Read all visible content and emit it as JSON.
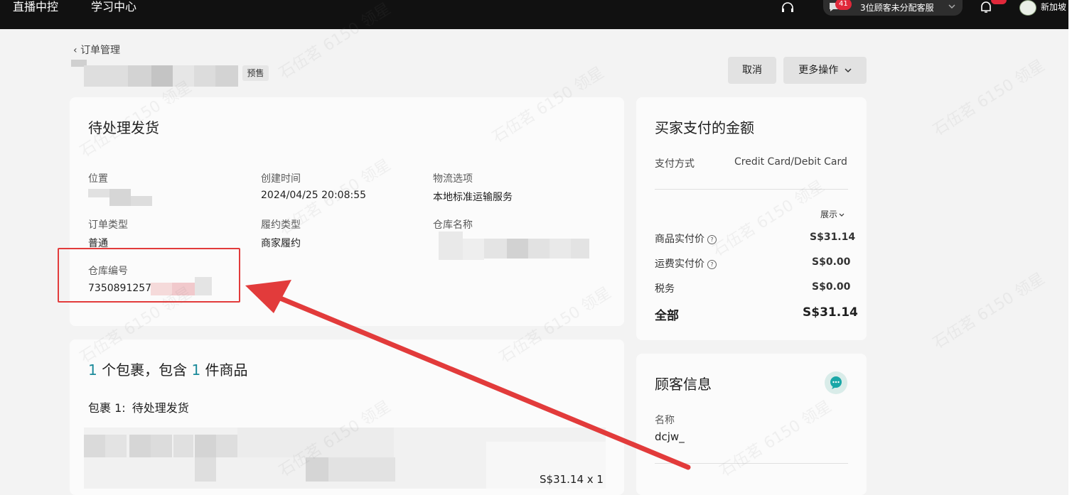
{
  "topbar": {
    "nav": [
      "直播中控",
      "学习中心"
    ],
    "chat_badge": "41",
    "chat_text": "3位顾客未分配客服",
    "region": "新加坡"
  },
  "page": {
    "breadcrumb": "订单管理",
    "presale_tag": "预售",
    "cancel_label": "取消",
    "more_label": "更多操作"
  },
  "status_card": {
    "title": "待处理发货",
    "location_label": "位置",
    "created_label": "创建时间",
    "created_value": "2024/04/25 20:08:55",
    "logistics_label": "物流选项",
    "logistics_value": "本地标准运输服务",
    "order_type_label": "订单类型",
    "order_type_value": "普通",
    "fulfill_label": "履约类型",
    "fulfill_value": "商家履约",
    "warehouse_name_label": "仓库名称",
    "warehouse_no_label": "仓库编号",
    "warehouse_no_value": "7350891257"
  },
  "package_card": {
    "count_pkg": "1",
    "text_mid": "个包裹，包含",
    "count_items": "1",
    "text_end": "件商品",
    "pkg_label": "包裹 1:",
    "pkg_status": "待处理发货",
    "price_qty": "S$31.14 x 1"
  },
  "payment_card": {
    "title": "买家支付的金额",
    "method_label": "支付方式",
    "method_value": "Credit Card/Debit Card",
    "expand_label": "展示",
    "rows": [
      {
        "label": "商品实付价",
        "value": "S$31.14"
      },
      {
        "label": "运费实付价",
        "value": "S$0.00"
      },
      {
        "label": "税务",
        "value": "S$0.00"
      }
    ],
    "total_label": "全部",
    "total_value": "S$31.14"
  },
  "customer_card": {
    "title": "顾客信息",
    "name_label": "名称",
    "name_value": "dcjw_"
  },
  "watermark": "石伍茗 6150 领星",
  "colors": {
    "annotation": "#e23b3b",
    "accent": "#1a8a9a",
    "topbar": "#111111"
  }
}
